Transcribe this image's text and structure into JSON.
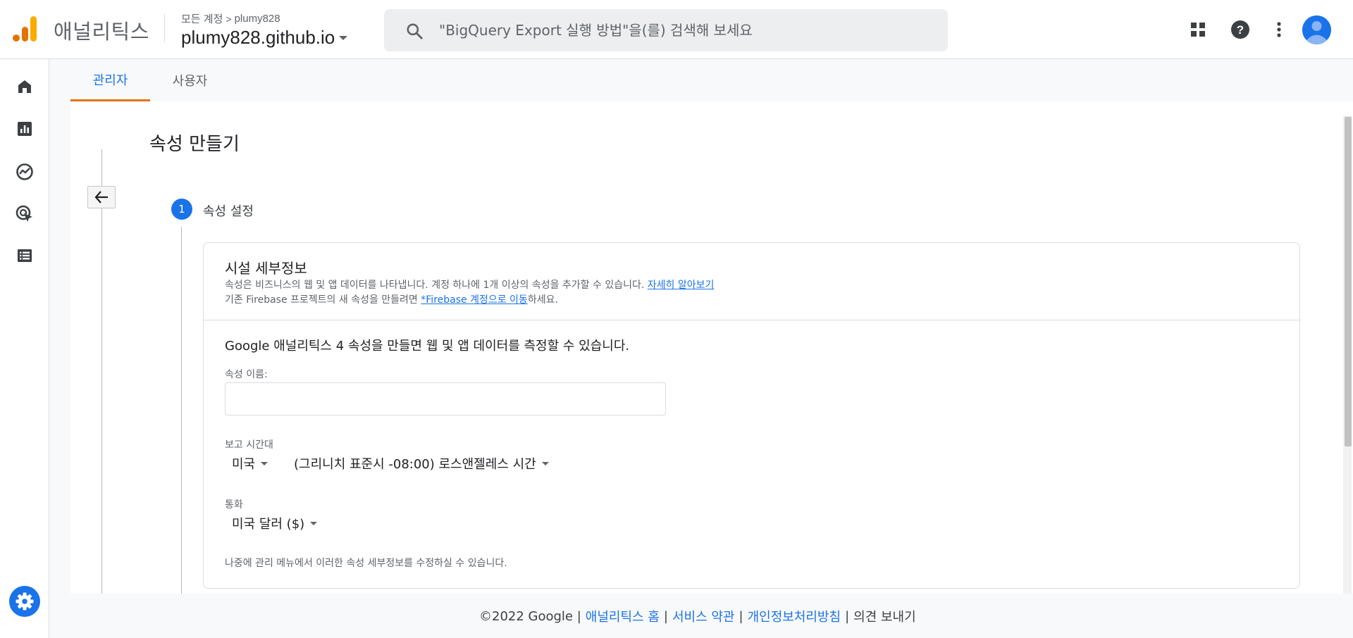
{
  "header": {
    "app_name": "애널리틱스",
    "breadcrumb": {
      "root": "모든 계정",
      "separator": ">",
      "account": "plumy828"
    },
    "property_name": "plumy828.github.io",
    "search_placeholder": "\"BigQuery Export 실행 방법\"을(를) 검색해 보세요",
    "icons": [
      "apps-grid-icon",
      "help-icon",
      "more-vert-icon",
      "account-avatar-icon"
    ]
  },
  "leftnav": {
    "items": [
      "home-icon",
      "reports-icon",
      "explore-icon",
      "advertising-icon",
      "configure-icon"
    ],
    "settings": "settings-icon"
  },
  "tabs": [
    {
      "label": "관리자",
      "active": true
    },
    {
      "label": "사용자",
      "active": false
    }
  ],
  "page": {
    "title": "속성 만들기",
    "step": {
      "number": "1",
      "label": "속성 설정"
    }
  },
  "card": {
    "title": "시설 세부정보",
    "desc_line1": "속성은 비즈니스의 웹 및 앱 데이터를 나타냅니다. 계정 하나에 1개 이상의 속성을 추가할 수 있습니다. ",
    "desc_link1": "자세히 알아보기",
    "desc_line2_prefix": "기존 Firebase 프로젝트의 새 속성을 만들려면 ",
    "desc_link2": "*Firebase 계정으로 이동",
    "desc_line2_suffix": "하세요.",
    "intro": "Google 애널리틱스 4 속성을 만들면 웹 및 앱 데이터를 측정할 수 있습니다.",
    "property_name_label": "속성 이름:",
    "property_name_value": "",
    "timezone_label": "보고 시간대",
    "country_value": "미국",
    "timezone_value": "(그리니치 표준시 -08:00) 로스앤젤레스 시간",
    "currency_label": "통화",
    "currency_value": "미국 달러 ($)",
    "footnote": "나중에 관리 메뉴에서 이러한 속성 세부정보를 수정하실 수 있습니다."
  },
  "footer": {
    "copyright": "©2022 Google |",
    "analytics_home": "애널리틱스 홈",
    "sep1": "|",
    "terms": "서비스 약관",
    "sep2": "|",
    "privacy": "개인정보처리방침",
    "sep3": "|",
    "feedback": "의견 보내기"
  },
  "colors": {
    "accent": "#1a73e8",
    "tab_underline": "#e8710a",
    "logo_orange": "#f9ab00",
    "logo_dark_orange": "#e37400"
  }
}
